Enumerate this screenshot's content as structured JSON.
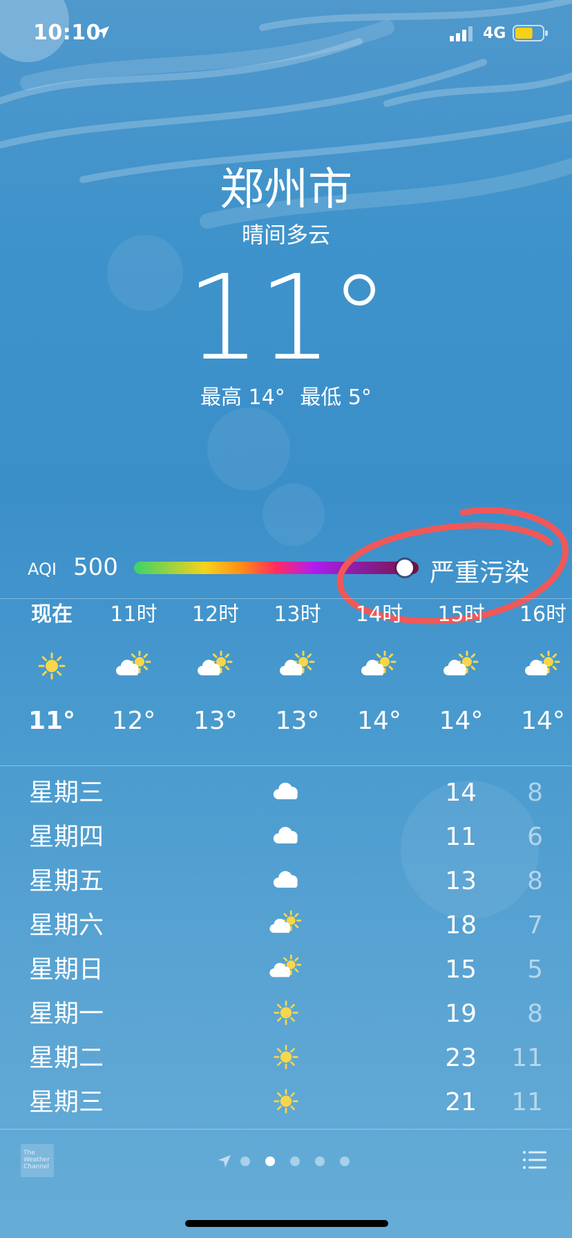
{
  "status_bar": {
    "time": "10:10",
    "network": "4G",
    "battery_level": 0.65,
    "battery_color": "#f7d117"
  },
  "header": {
    "city": "郑州市",
    "condition": "晴间多云",
    "temperature": "11°",
    "high": "最高 14°",
    "low": "最低 5°"
  },
  "aqi": {
    "label": "AQI",
    "value": "500",
    "status": "严重污染",
    "level": 1.0
  },
  "hourly": [
    {
      "time": "现在",
      "icon": "sun-icon",
      "temp": "11°"
    },
    {
      "time": "11时",
      "icon": "partly-cloudy-icon",
      "temp": "12°"
    },
    {
      "time": "12时",
      "icon": "partly-cloudy-icon",
      "temp": "13°"
    },
    {
      "time": "13时",
      "icon": "partly-cloudy-icon",
      "temp": "13°"
    },
    {
      "time": "14时",
      "icon": "partly-cloudy-icon",
      "temp": "14°"
    },
    {
      "time": "15时",
      "icon": "partly-cloudy-icon",
      "temp": "14°"
    },
    {
      "time": "16时",
      "icon": "partly-cloudy-icon",
      "temp": "14°"
    }
  ],
  "daily": [
    {
      "day": "星期三",
      "icon": "cloud-icon",
      "high": "14",
      "low": "8"
    },
    {
      "day": "星期四",
      "icon": "cloud-icon",
      "high": "11",
      "low": "6"
    },
    {
      "day": "星期五",
      "icon": "cloud-icon",
      "high": "13",
      "low": "8"
    },
    {
      "day": "星期六",
      "icon": "partly-cloudy-icon",
      "high": "18",
      "low": "7"
    },
    {
      "day": "星期日",
      "icon": "partly-cloudy-icon",
      "high": "15",
      "low": "5"
    },
    {
      "day": "星期一",
      "icon": "sun-icon",
      "high": "19",
      "low": "8"
    },
    {
      "day": "星期二",
      "icon": "sun-icon",
      "high": "23",
      "low": "11"
    },
    {
      "day": "星期三",
      "icon": "sun-icon",
      "high": "21",
      "low": "11"
    }
  ],
  "footer": {
    "logo_text": "The Weather Channel",
    "pages": 5,
    "active_page": 2
  },
  "colors": {
    "sun": "#f7d64a",
    "annotation": "#f05858"
  }
}
